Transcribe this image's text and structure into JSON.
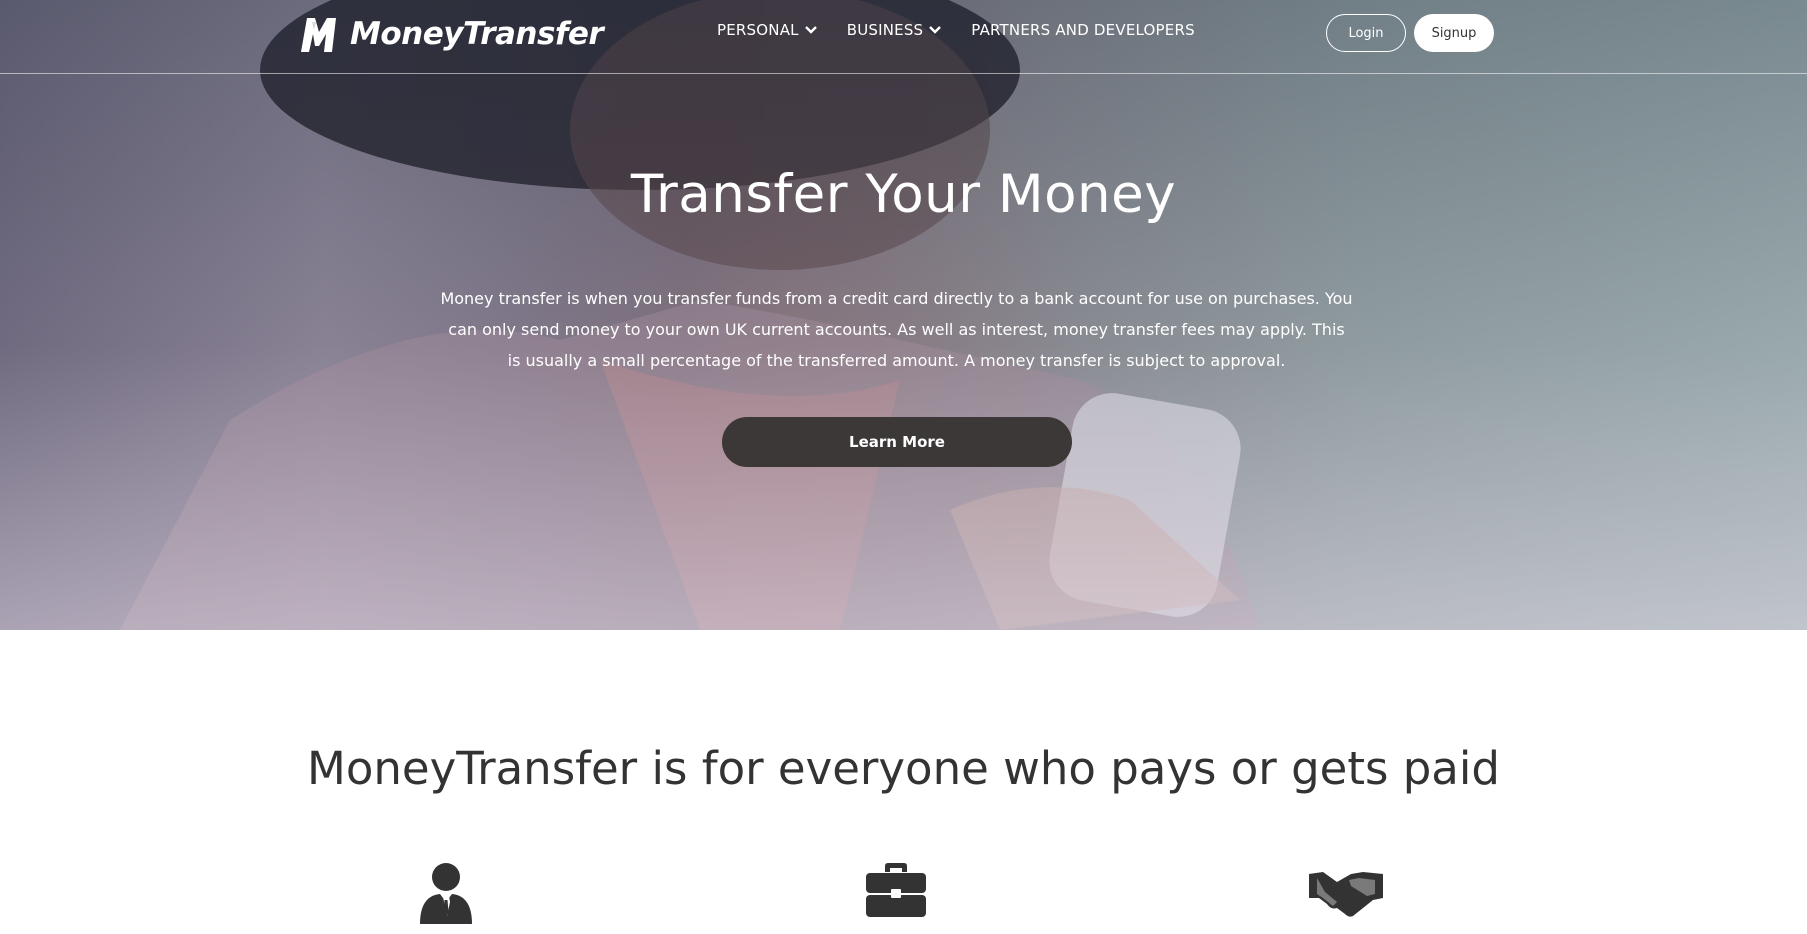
{
  "brand": {
    "name": "MoneyTransfer",
    "logo_icon": "m-logo-icon"
  },
  "nav": {
    "items": [
      {
        "label": "PERSONAL",
        "has_dropdown": true,
        "icon": "chevron-down-icon"
      },
      {
        "label": "BUSINESS",
        "has_dropdown": true,
        "icon": "chevron-down-icon"
      },
      {
        "label": "PARTNERS AND DEVELOPERS",
        "has_dropdown": false
      }
    ],
    "login_label": "Login",
    "signup_label": "Signup"
  },
  "hero": {
    "title": "Transfer Your Money",
    "text": "Money transfer is when you transfer funds from a credit card directly to a bank account for use on purchases. You can only send money to your own UK current accounts. As well as interest, money transfer fees may apply. This is usually a small percentage of the transferred amount. A money transfer is subject to approval.",
    "cta_label": "Learn More"
  },
  "audience": {
    "title": "MoneyTransfer is for everyone who pays or gets paid",
    "icons": [
      "businessman-icon",
      "briefcase-icon",
      "handshake-icon"
    ]
  },
  "colors": {
    "button_dark": "#3b3837",
    "text_dark": "#333333",
    "white": "#ffffff"
  }
}
